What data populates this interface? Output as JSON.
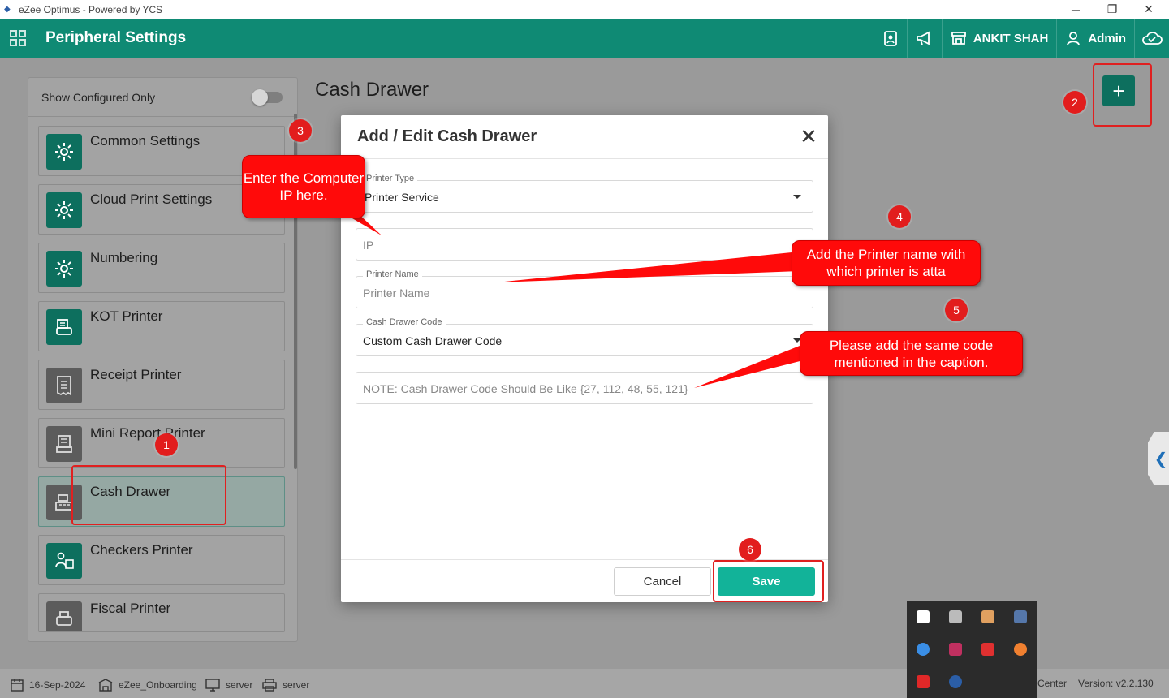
{
  "window": {
    "title": "eZee Optimus - Powered by YCS",
    "minimize": "─",
    "restore": "❐",
    "close": "✕"
  },
  "header": {
    "title": "Peripheral Settings",
    "user": "ANKIT SHAH",
    "role": "Admin"
  },
  "sidebar": {
    "show_configured_label": "Show Configured Only",
    "show_configured_on": false,
    "items": [
      {
        "label": "Common Settings",
        "icon": "gear-icon"
      },
      {
        "label": "Cloud Print Settings",
        "icon": "gear-icon"
      },
      {
        "label": "Numbering",
        "icon": "gear-icon"
      },
      {
        "label": "KOT Printer",
        "icon": "kot-printer-icon"
      },
      {
        "label": "Receipt Printer",
        "icon": "receipt-icon"
      },
      {
        "label": "Mini Report Printer",
        "icon": "report-icon"
      },
      {
        "label": "Cash Drawer",
        "icon": "cash-register-icon",
        "active": true
      },
      {
        "label": "Checkers Printer",
        "icon": "checker-icon"
      },
      {
        "label": "Fiscal Printer",
        "icon": "fiscal-printer-icon"
      }
    ]
  },
  "main": {
    "heading": "Cash Drawer",
    "add_symbol": "+"
  },
  "modal": {
    "title": "Add / Edit Cash Drawer",
    "close_symbol": "✕",
    "printer_type_label": "Printer Type",
    "printer_type_value": "Printer Service",
    "ip_placeholder": "IP",
    "printer_name_label": "Printer Name",
    "printer_name_placeholder": "Printer Name",
    "cash_drawer_code_label": "Cash Drawer Code",
    "cash_drawer_code_value": "Custom Cash Drawer Code",
    "custom_code_placeholder": "NOTE: Cash Drawer Code Should Be Like {27, 112, 48, 55, 121}",
    "cancel_label": "Cancel",
    "save_label": "Save"
  },
  "annotations": {
    "numbers": [
      "1",
      "2",
      "3",
      "4",
      "5",
      "6"
    ],
    "callout_ip": "Enter the Computer IP here.",
    "callout_printer_name": "Add the Printer name with which printer is atta",
    "callout_code": "Please add the same code mentioned in the caption.",
    "color": "#ff0a0a"
  },
  "statusbar": {
    "date": "16-Sep-2024",
    "property": "eZee_Onboarding",
    "terminal": "server",
    "printer": "server",
    "center_fragment": "Center",
    "version": "Version: v2.2.130"
  },
  "colors": {
    "brand": "#0f8a74",
    "save": "#12b399",
    "annotation": "#e21d1d"
  }
}
